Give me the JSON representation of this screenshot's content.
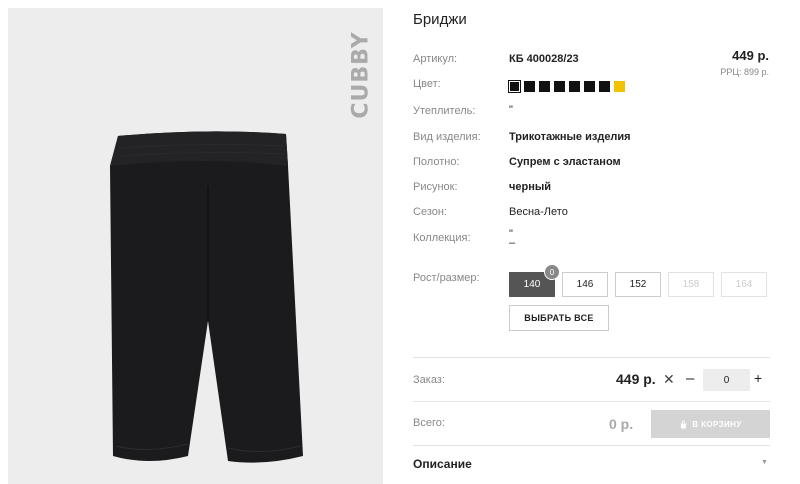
{
  "product": {
    "brand": "CUBBY",
    "title": "Бриджи",
    "price": "449 р.",
    "rrp": "РРЦ: 899 р."
  },
  "attributes": [
    {
      "label": "Артикул:",
      "value": "КБ 400028/23"
    },
    {
      "label": "Цвет:",
      "value": ""
    },
    {
      "label": "Утеплитель:",
      "value": "\""
    },
    {
      "label": "Вид изделия:",
      "value": "Трикотажные изделия"
    },
    {
      "label": "Полотно:",
      "value": "Супрем с эластаном"
    },
    {
      "label": "Рисунок:",
      "value": "черный"
    },
    {
      "label": "Сезон:",
      "value": "Весна-Лето"
    },
    {
      "label": "Коллекция:",
      "value": "\"\n–"
    }
  ],
  "colors": [
    "#111111",
    "#111111",
    "#111111",
    "#111111",
    "#111111",
    "#111111",
    "#111111",
    "#f2c200"
  ],
  "size_label": "Рост/размер:",
  "sizes": [
    {
      "label": "140",
      "state": "selected",
      "badge": "0"
    },
    {
      "label": "146",
      "state": "available"
    },
    {
      "label": "152",
      "state": "available"
    },
    {
      "label": "158",
      "state": "unavailable"
    },
    {
      "label": "164",
      "state": "unavailable"
    }
  ],
  "select_all_label": "ВЫБРАТЬ ВСЕ",
  "order": {
    "label": "Заказ:",
    "price": "449 р.",
    "times": "✕",
    "minus": "–",
    "quantity": "0",
    "plus": "+"
  },
  "total": {
    "label": "Всего:",
    "value": "0 р.",
    "cart_button": "В КОРЗИНУ",
    "cart_icon": "bag-icon"
  },
  "description": {
    "label": "Описание",
    "chevron_icon": "chevron-down-icon"
  }
}
